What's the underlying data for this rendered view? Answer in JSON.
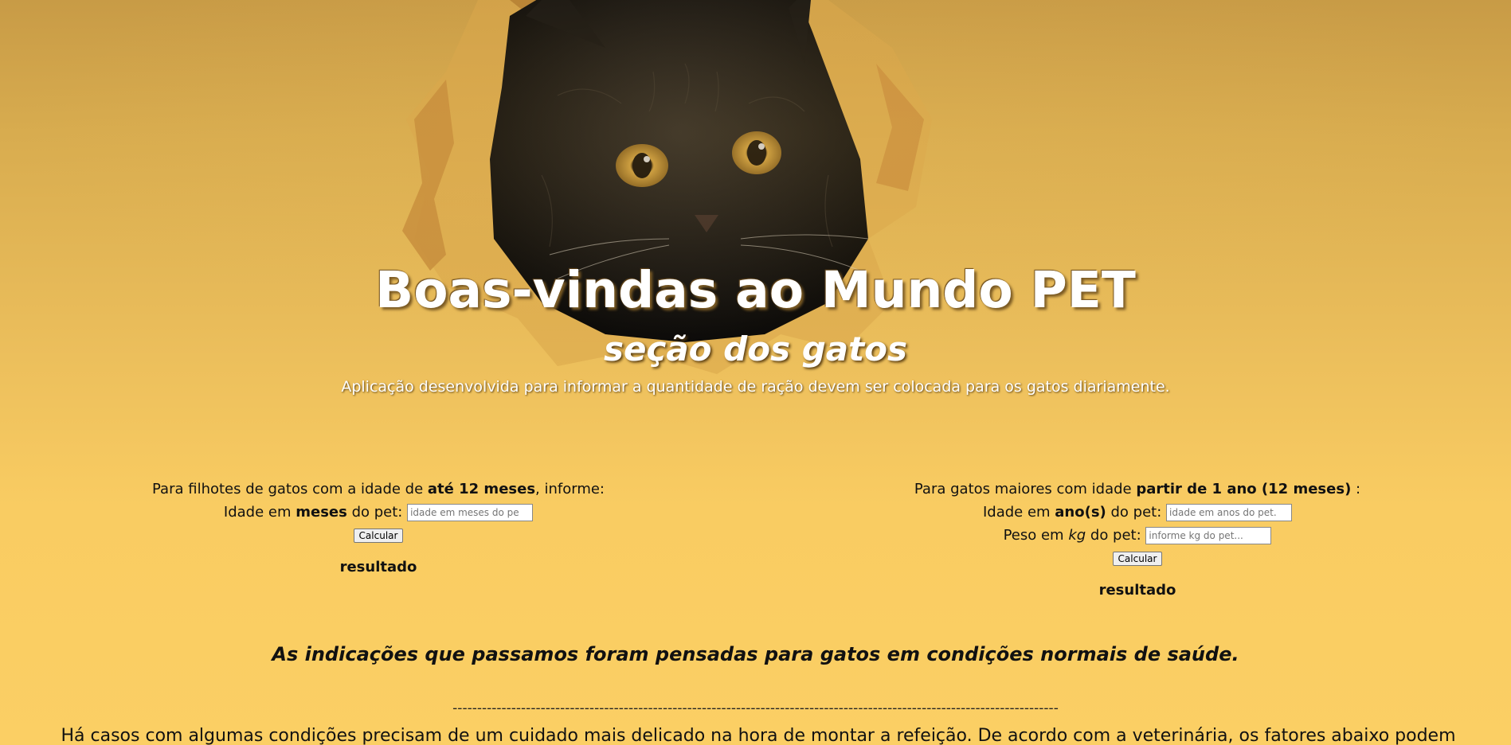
{
  "header": {
    "title": "Boas-vindas ao Mundo PET",
    "subtitle": "seção dos gatos",
    "description": "Aplicação desenvolvida para informar a quantidade de ração devem ser colocada para os gatos diariamente."
  },
  "kitten_form": {
    "intro_prefix": "Para filhotes de gatos com a idade de ",
    "intro_bold": "até 12 meses",
    "intro_suffix": ", informe:",
    "age_label_prefix": "Idade em ",
    "age_label_bold": "meses",
    "age_label_suffix": " do pet:",
    "age_placeholder": "idade em meses do pe",
    "button_label": "Calcular",
    "result_label": "resultado"
  },
  "adult_form": {
    "intro_prefix": "Para gatos maiores com idade ",
    "intro_bold": "partir de 1 ano (12 meses)",
    "intro_suffix": " :",
    "age_label_prefix": "Idade em ",
    "age_label_bold": "ano(s)",
    "age_label_suffix": " do pet:",
    "age_placeholder": "idade em anos do pet.",
    "weight_label_prefix": "Peso em ",
    "weight_label_italic": "kg",
    "weight_label_suffix": " do pet:",
    "weight_placeholder": "informe kg do pet...",
    "button_label": "Calcular",
    "result_label": "resultado"
  },
  "note": "As indicações que passamos foram pensadas para gatos em condições normais de saúde.",
  "divider": "----------------------------------------------------------------------------------------------------------------------------",
  "bottom_text": "Há casos com algumas condições precisam de um cuidado mais delicado na hora de montar a refeição. De acordo com a veterinária, os fatores abaixo podem",
  "colors": {
    "background_top": "#c89b46",
    "background_bottom": "#fbcf64",
    "title_text": "#ffffff"
  }
}
